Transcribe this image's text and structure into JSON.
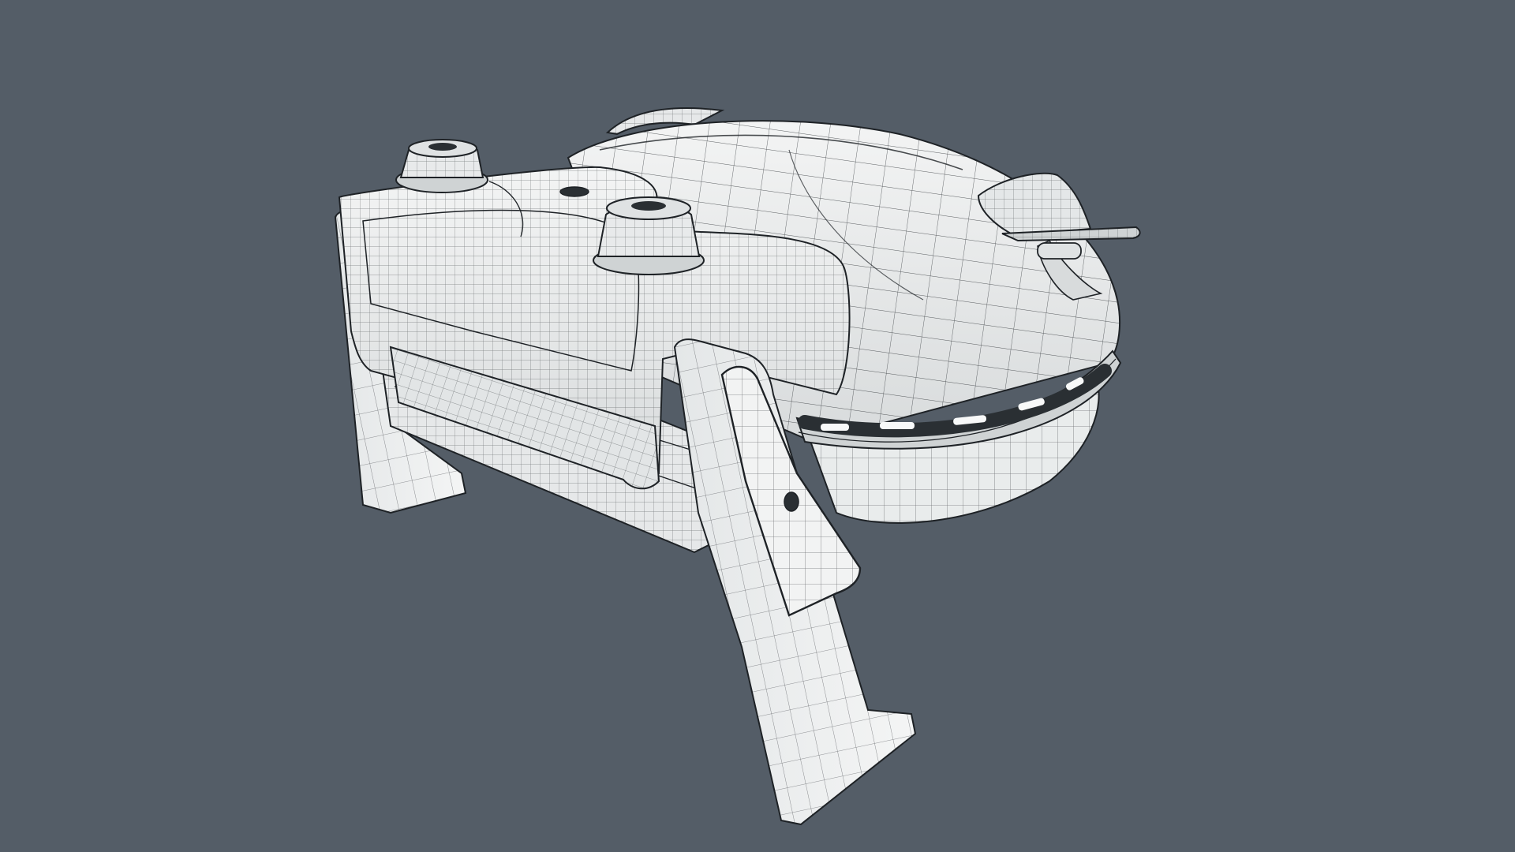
{
  "viewport": {
    "background_color": "#545d67",
    "render_mode": "wireframe-on-shaded"
  },
  "model": {
    "subject": "waffle maker",
    "shade_color": "#eef0f0",
    "shadow_color": "#c7cbcc",
    "wire_color": "#1e2226",
    "cavity_color": "#2a2f33",
    "parts": [
      "body-dome",
      "front-housing",
      "knob-left",
      "knob-right",
      "stand-front",
      "stand-rear",
      "drip-tray",
      "side-handle",
      "led-strip",
      "pivot-hole"
    ]
  }
}
